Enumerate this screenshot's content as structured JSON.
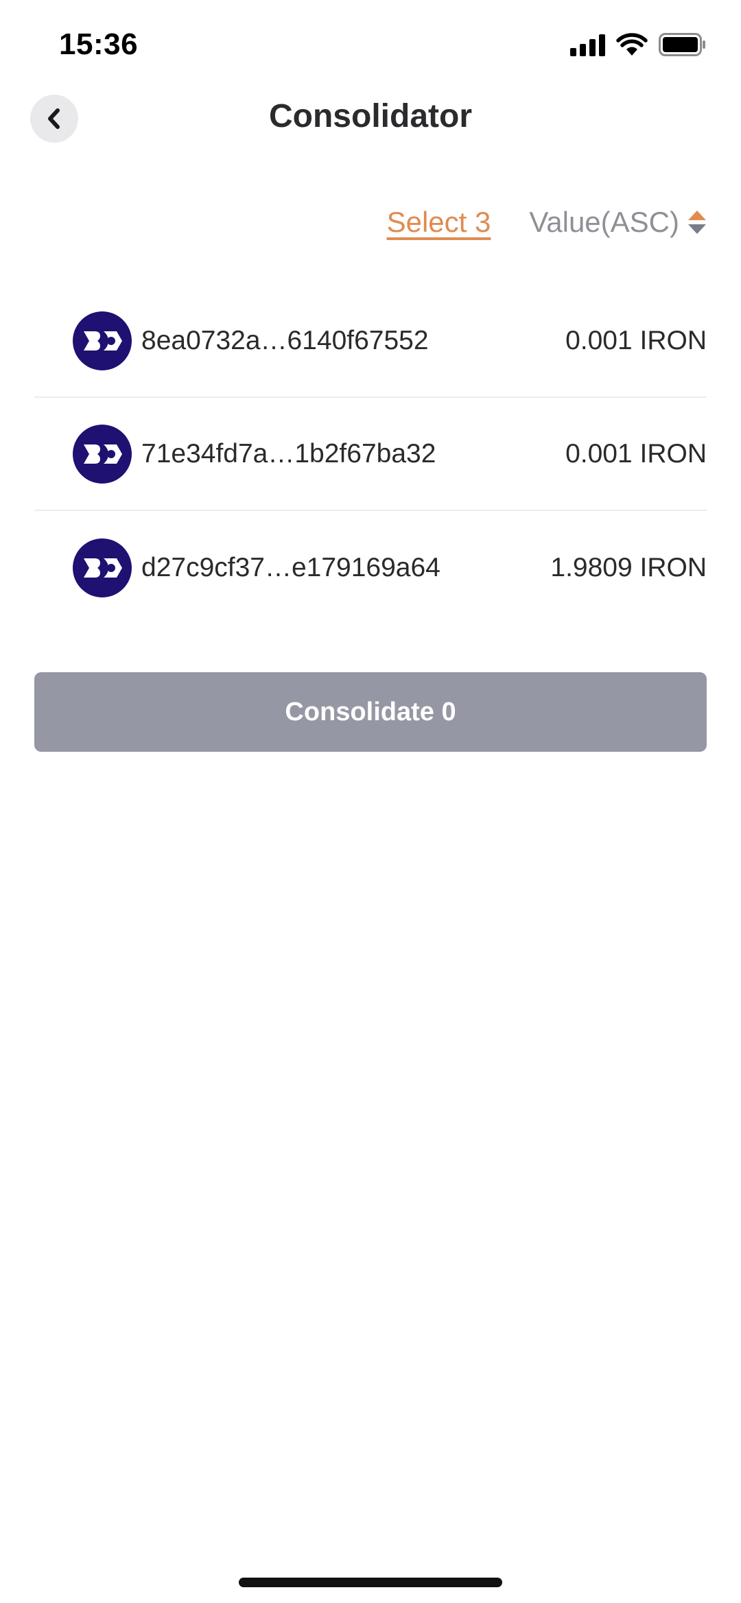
{
  "status_bar": {
    "time": "15:36"
  },
  "header": {
    "title": "Consolidator"
  },
  "toolbar": {
    "select_label": "Select 3",
    "sort_label": "Value(ASC)"
  },
  "coins": [
    {
      "hash": "8ea0732a…6140f67552",
      "amount": "0.001 IRON",
      "icon": "iron-logo-icon"
    },
    {
      "hash": "71e34fd7a…1b2f67ba32",
      "amount": "0.001 IRON",
      "icon": "iron-logo-icon"
    },
    {
      "hash": "d27c9cf37…e179169a64",
      "amount": "1.9809 IRON",
      "icon": "iron-logo-icon"
    }
  ],
  "consolidate_button": {
    "label": "Consolidate 0"
  },
  "colors": {
    "accent": "#e08b52",
    "logo_bg": "#1e1172",
    "button_disabled": "#9598a4",
    "sort_down": "#7a7c8c"
  }
}
